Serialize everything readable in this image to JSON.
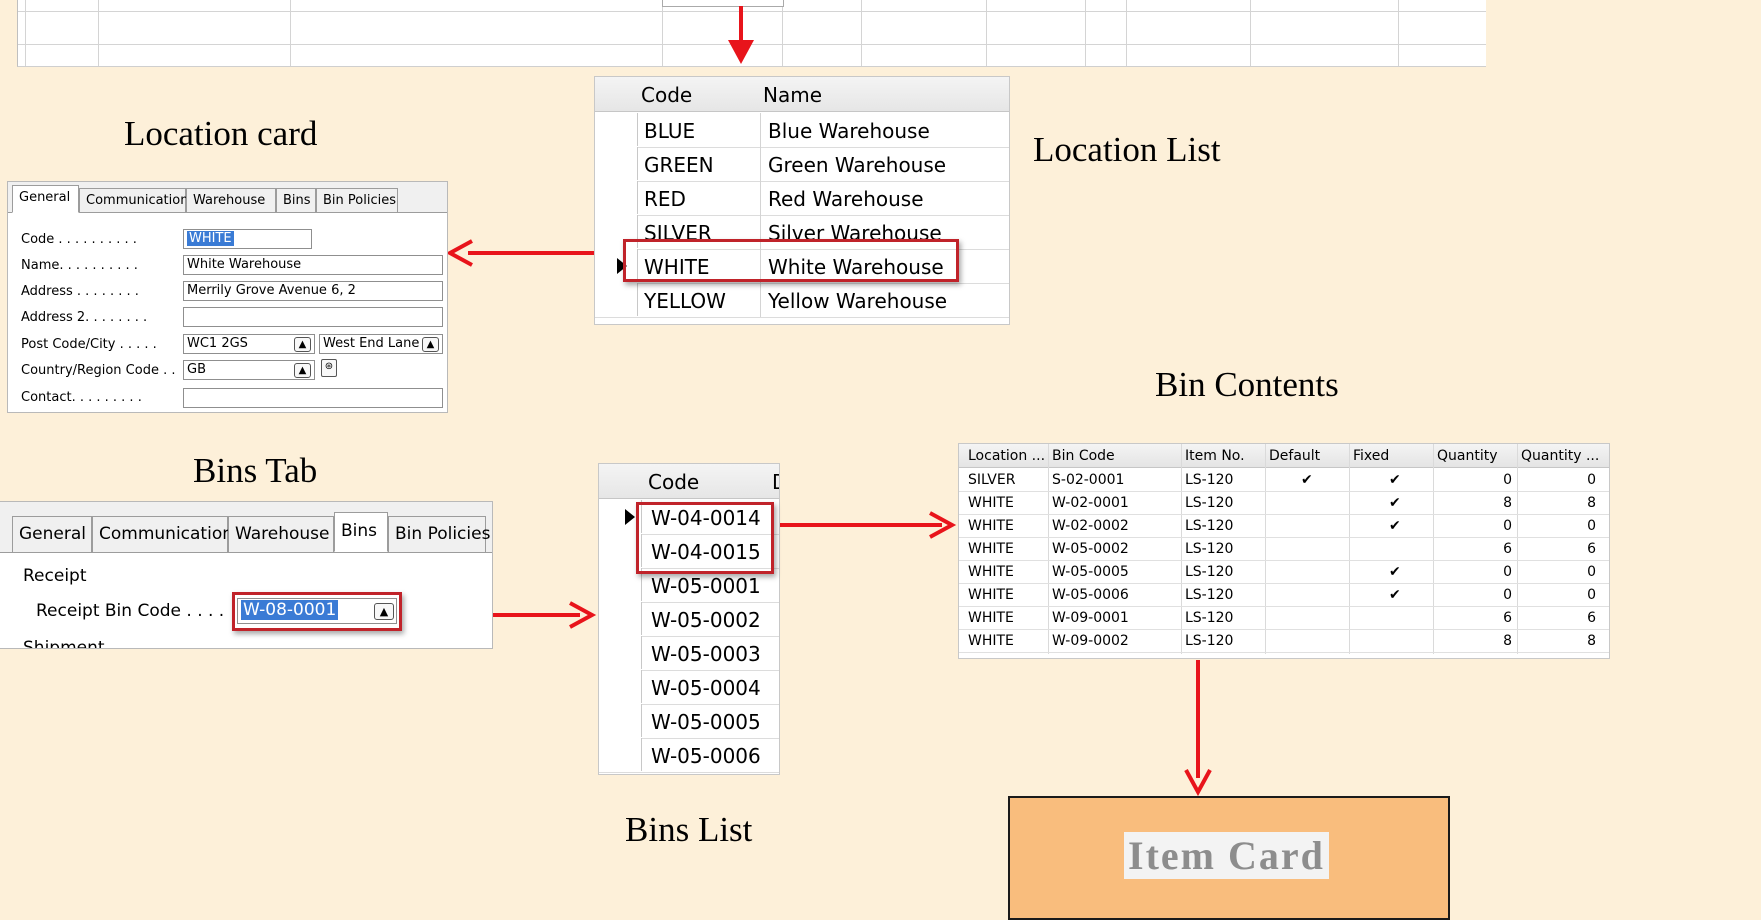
{
  "titles": {
    "location_card": "Location card",
    "location_list": "Location List",
    "bins_tab": "Bins Tab",
    "bins_list": "Bins List",
    "bin_contents": "Bin Contents",
    "item_card": "Item Card"
  },
  "location_list": {
    "headers": {
      "code": "Code",
      "name": "Name"
    },
    "rows": [
      {
        "code": "BLUE",
        "name": "Blue Warehouse"
      },
      {
        "code": "GREEN",
        "name": "Green Warehouse"
      },
      {
        "code": "RED",
        "name": "Red Warehouse"
      },
      {
        "code": "SILVER",
        "name": "Silver Warehouse"
      },
      {
        "code": "WHITE",
        "name": "White Warehouse"
      },
      {
        "code": "YELLOW",
        "name": "Yellow Warehouse"
      }
    ]
  },
  "location_card": {
    "tabs": [
      "General",
      "Communication",
      "Warehouse",
      "Bins",
      "Bin Policies"
    ],
    "fields": {
      "code_label": "Code . . . . . . . . . .",
      "code_value": "WHITE",
      "name_label": "Name. . . . . . . . . .",
      "name_value": "White Warehouse",
      "address_label": "Address . . . . . . . .",
      "address_value": "Merrily Grove Avenue 6, 2",
      "address2_label": "Address 2. . . . . . . .",
      "postcode_label": "Post Code/City . . . . .",
      "postcode_value": "WC1 2GS",
      "city_value": "West End Lane",
      "country_label": "Country/Region Code . .",
      "country_value": "GB",
      "contact_label": "Contact. . . . . . . . ."
    }
  },
  "bins_tab": {
    "tabs": [
      "General",
      "Communication",
      "Warehouse",
      "Bins",
      "Bin Policies"
    ],
    "section": "Receipt",
    "receipt_bin_label": "Receipt Bin Code . . . .",
    "receipt_bin_value": "W-08-0001",
    "next_section": "Shipment"
  },
  "bins_list": {
    "header": "Code",
    "header_cut": "D",
    "rows": [
      "W-04-0014",
      "W-04-0015",
      "W-05-0001",
      "W-05-0002",
      "W-05-0003",
      "W-05-0004",
      "W-05-0005",
      "W-05-0006"
    ]
  },
  "bin_contents": {
    "headers": [
      "Location ...",
      "Bin Code",
      "Item No.",
      "Default",
      "Fixed",
      "Quantity",
      "Quantity ..."
    ],
    "rows": [
      {
        "location": "SILVER",
        "bin": "S-02-0001",
        "item": "LS-120",
        "default": "✔",
        "fixed": "✔",
        "qty": "0",
        "qty2": "0"
      },
      {
        "location": "WHITE",
        "bin": "W-02-0001",
        "item": "LS-120",
        "default": "",
        "fixed": "✔",
        "qty": "8",
        "qty2": "8"
      },
      {
        "location": "WHITE",
        "bin": "W-02-0002",
        "item": "LS-120",
        "default": "",
        "fixed": "✔",
        "qty": "0",
        "qty2": "0"
      },
      {
        "location": "WHITE",
        "bin": "W-05-0002",
        "item": "LS-120",
        "default": "",
        "fixed": "",
        "qty": "6",
        "qty2": "6"
      },
      {
        "location": "WHITE",
        "bin": "W-05-0005",
        "item": "LS-120",
        "default": "",
        "fixed": "✔",
        "qty": "0",
        "qty2": "0"
      },
      {
        "location": "WHITE",
        "bin": "W-05-0006",
        "item": "LS-120",
        "default": "",
        "fixed": "✔",
        "qty": "0",
        "qty2": "0"
      },
      {
        "location": "WHITE",
        "bin": "W-09-0001",
        "item": "LS-120",
        "default": "",
        "fixed": "",
        "qty": "6",
        "qty2": "6"
      },
      {
        "location": "WHITE",
        "bin": "W-09-0002",
        "item": "LS-120",
        "default": "",
        "fixed": "",
        "qty": "8",
        "qty2": "8"
      }
    ]
  },
  "colors": {
    "background": "#fdf0d9",
    "arrow": "#e8141b",
    "highlight_box": "#c0232a",
    "item_card_fill": "#f9bd7d",
    "selection": "#3a7bd5"
  }
}
